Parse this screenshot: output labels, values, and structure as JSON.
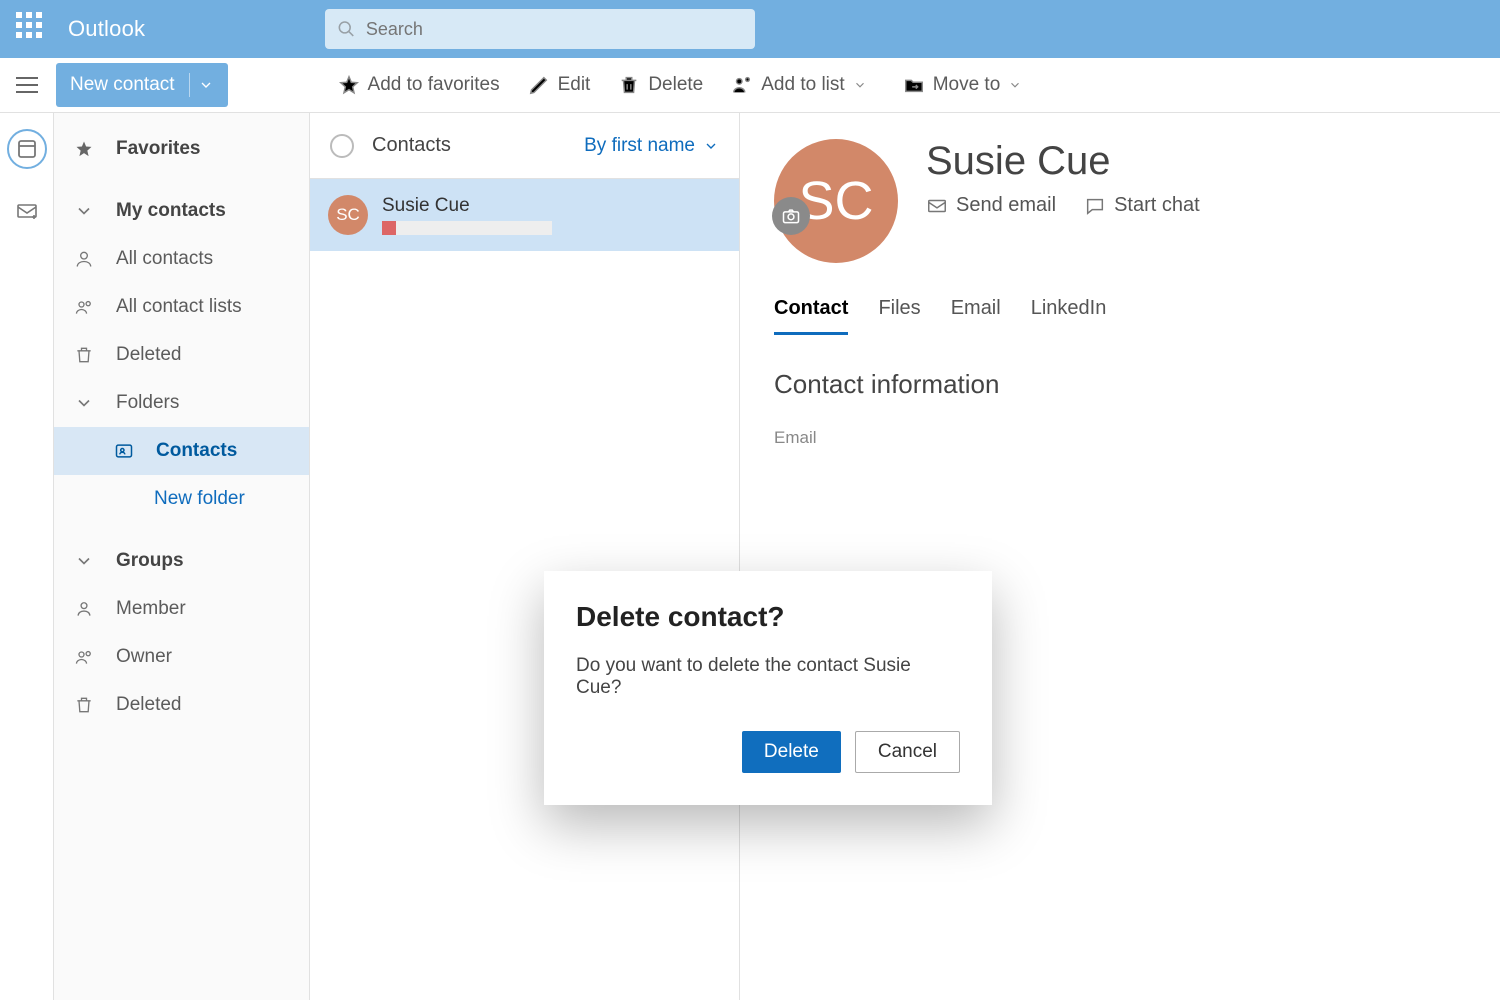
{
  "header": {
    "brand": "Outlook",
    "search_placeholder": "Search"
  },
  "commands": {
    "new_contact": "New contact",
    "add_favorites": "Add to favorites",
    "edit": "Edit",
    "delete": "Delete",
    "add_to_list": "Add to list",
    "move_to": "Move to"
  },
  "nav": {
    "favorites": "Favorites",
    "my_contacts": "My contacts",
    "all_contacts": "All contacts",
    "all_contact_lists": "All contact lists",
    "deleted": "Deleted",
    "folders": "Folders",
    "contacts_folder": "Contacts",
    "new_folder": "New folder",
    "groups": "Groups",
    "member": "Member",
    "owner": "Owner",
    "groups_deleted": "Deleted"
  },
  "list": {
    "header": "Contacts",
    "sort_label": "By first name",
    "items": [
      {
        "initials": "SC",
        "name": "Susie Cue"
      }
    ]
  },
  "detail": {
    "initials": "SC",
    "name": "Susie Cue",
    "send_email": "Send email",
    "start_chat": "Start chat",
    "tabs": {
      "contact": "Contact",
      "files": "Files",
      "email": "Email",
      "linkedin": "LinkedIn"
    },
    "section_title": "Contact information",
    "email_label": "Email"
  },
  "dialog": {
    "title": "Delete contact?",
    "body": "Do you want to delete the contact Susie Cue?",
    "primary": "Delete",
    "secondary": "Cancel"
  }
}
